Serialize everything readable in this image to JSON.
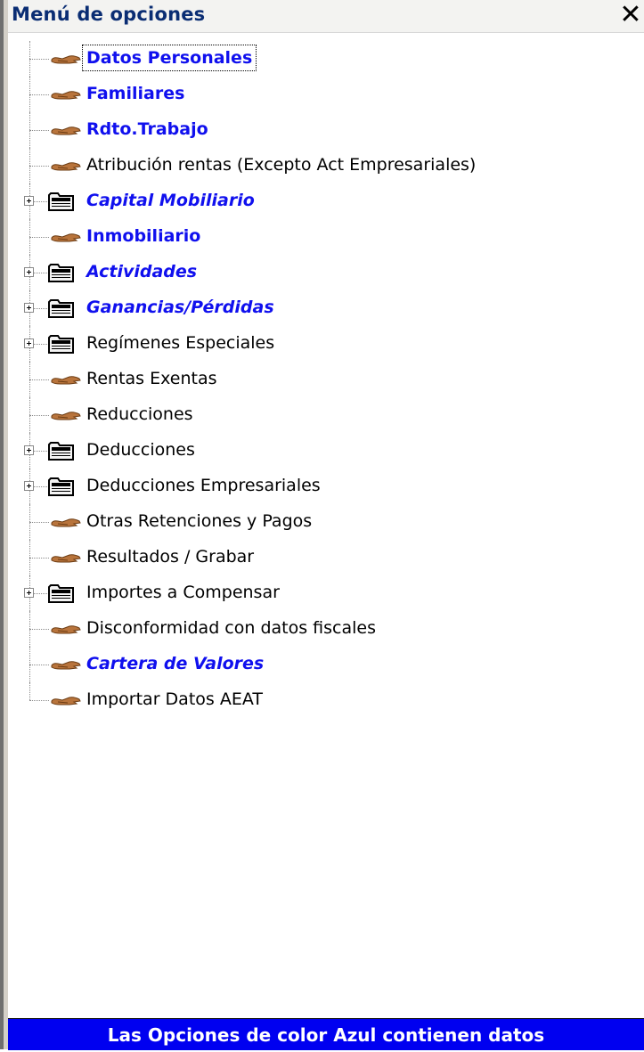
{
  "window": {
    "title": "Menú de opciones",
    "close_icon": "close-icon"
  },
  "colors": {
    "data_item": "#1010ee",
    "status_bg": "#0000f0",
    "title_text": "#0a2d73"
  },
  "tree": {
    "items": [
      {
        "label": "Datos Personales",
        "type": "leaf",
        "has_data": true,
        "selected": true
      },
      {
        "label": "Familiares",
        "type": "leaf",
        "has_data": true
      },
      {
        "label": "Rdto.Trabajo",
        "type": "leaf",
        "has_data": true
      },
      {
        "label": "Atribución rentas (Excepto Act Empresariales)",
        "type": "leaf",
        "has_data": false
      },
      {
        "label": "Capital Mobiliario",
        "type": "folder",
        "has_data": true
      },
      {
        "label": "Inmobiliario",
        "type": "leaf",
        "has_data": true
      },
      {
        "label": "Actividades",
        "type": "folder",
        "has_data": true
      },
      {
        "label": "Ganancias/Pérdidas",
        "type": "folder",
        "has_data": true
      },
      {
        "label": "Regímenes Especiales",
        "type": "folder",
        "has_data": false
      },
      {
        "label": "Rentas Exentas",
        "type": "leaf",
        "has_data": false
      },
      {
        "label": "Reducciones",
        "type": "leaf",
        "has_data": false
      },
      {
        "label": "Deducciones",
        "type": "folder",
        "has_data": false
      },
      {
        "label": "Deducciones Empresariales",
        "type": "folder",
        "has_data": false
      },
      {
        "label": "Otras Retenciones y Pagos",
        "type": "leaf",
        "has_data": false
      },
      {
        "label": "Resultados / Grabar",
        "type": "leaf",
        "has_data": false
      },
      {
        "label": "Importes a Compensar",
        "type": "folder",
        "has_data": false
      },
      {
        "label": "Disconformidad con datos fiscales",
        "type": "leaf",
        "has_data": false
      },
      {
        "label": "Cartera de Valores",
        "type": "leaf",
        "has_data": true
      },
      {
        "label": "Importar Datos AEAT",
        "type": "leaf",
        "has_data": false
      }
    ]
  },
  "status": {
    "text": "Las Opciones de color Azul contienen datos"
  }
}
